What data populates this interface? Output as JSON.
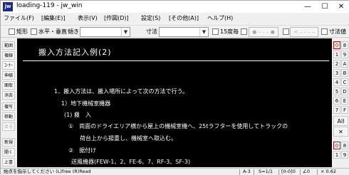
{
  "window": {
    "title": "loading-119 - jw_win",
    "icon_text": "jw",
    "minimize": "—",
    "maximize": "☐",
    "close": "✕"
  },
  "menu": [
    "ファイル(F)",
    "[編集(E)]",
    "表示(V)",
    "[作図(D)]",
    "設定(S)",
    "[その他(A)]",
    "ヘルプ(H)"
  ],
  "toolbar": {
    "rect": "矩形",
    "hv": "水平・垂直",
    "slope": "傾き",
    "size": "寸法",
    "deg15": "15度毎",
    "dim_value": "寸法値",
    "lt": "<",
    "pbox1": "● – – – ●",
    "pbox2": "< – – – –"
  },
  "left_tools": [
    {
      "label": "範囲",
      "enabled": true
    },
    {
      "label": "複線",
      "enabled": true
    },
    {
      "label": "ｺｰﾅｰ",
      "enabled": true
    },
    {
      "label": "伸縮",
      "enabled": true
    },
    {
      "label": "面取",
      "enabled": true
    },
    {
      "label": "消去",
      "enabled": true
    },
    {
      "label": "複写",
      "enabled": true
    },
    {
      "label": "移動",
      "enabled": true
    },
    {
      "label": "戻る",
      "enabled": false
    },
    {
      "label": "新規",
      "enabled": true
    },
    {
      "label": "開く",
      "enabled": true
    },
    {
      "label": "上書",
      "enabled": true
    }
  ],
  "canvas": {
    "heading": "搬入方法記入例(2)",
    "lines": [
      "1．搬入方法は、搬入場所によって次の方法で行う。",
      "1）地下機械室機器",
      "(1) 搬　入",
      "①　両面のドライエリア横から屋上の機械室機へ、25tラフターを使用してトラックの",
      "荷台上から揚重し、機械室へ取込む。",
      "②　据付け",
      "送風機器(FEW-1、2、FE-6、7、RF-3、SF-3)"
    ]
  },
  "right_tools": {
    "layers": [
      {
        "a": "0",
        "b": "8",
        "a_red": true
      },
      {
        "a": "1",
        "b": "9"
      },
      {
        "a": "2",
        "b": "A"
      },
      {
        "a": "3",
        "b": "B"
      },
      {
        "a": "4",
        "b": "C"
      },
      {
        "a": "5",
        "b": "D"
      },
      {
        "a": "6",
        "b": "E"
      },
      {
        "a": "7",
        "b": "F"
      }
    ],
    "all": "All",
    "x": "✕",
    "groups": [
      {
        "a": "0",
        "b": "8",
        "a_red": true
      },
      {
        "a": "1",
        "b": "9"
      }
    ]
  },
  "status": {
    "message": "始点を指示してください (L)free (R)Read",
    "paper": "A-3",
    "scale": "S=1/1",
    "layer": "[0-0]0",
    "angle": "∠0",
    "zoom": "× 0.62"
  }
}
